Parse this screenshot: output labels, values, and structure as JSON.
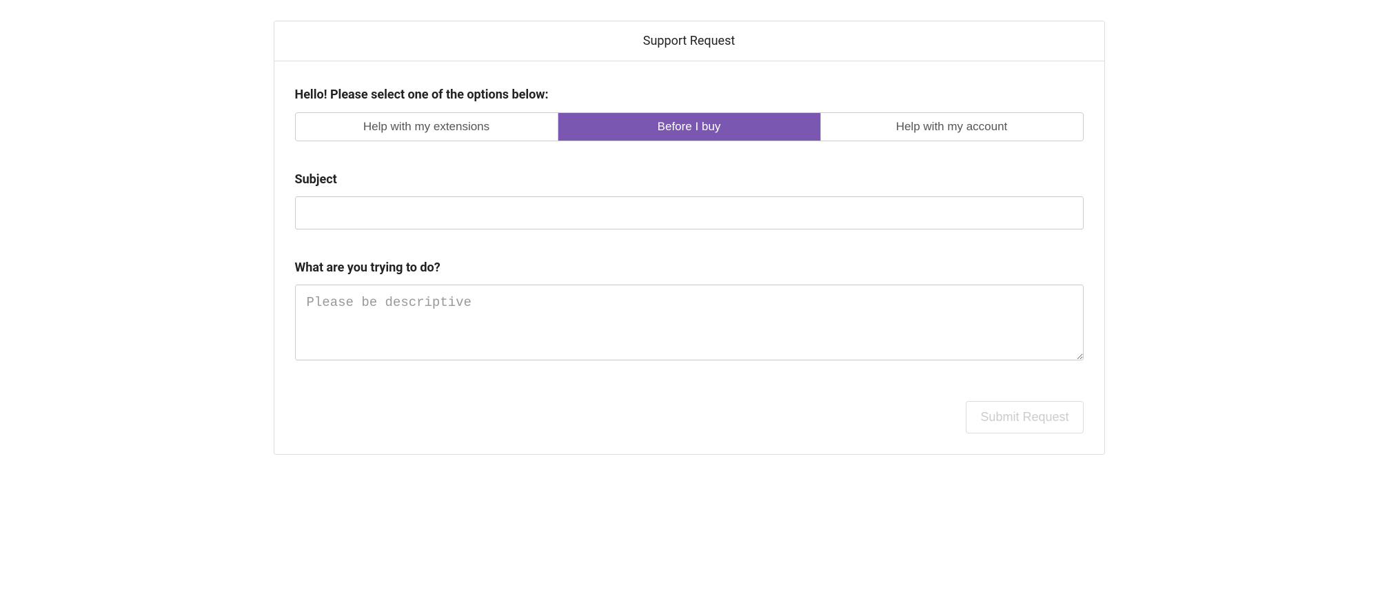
{
  "header": {
    "title": "Support Request"
  },
  "form": {
    "prompt": "Hello! Please select one of the options below:",
    "options": {
      "extensions": "Help with my extensions",
      "before_buy": "Before I buy",
      "account": "Help with my account"
    },
    "subject_label": "Subject",
    "subject_value": "",
    "description_label": "What are you trying to do?",
    "description_placeholder": "Please be descriptive",
    "description_value": "",
    "submit_label": "Submit Request"
  }
}
